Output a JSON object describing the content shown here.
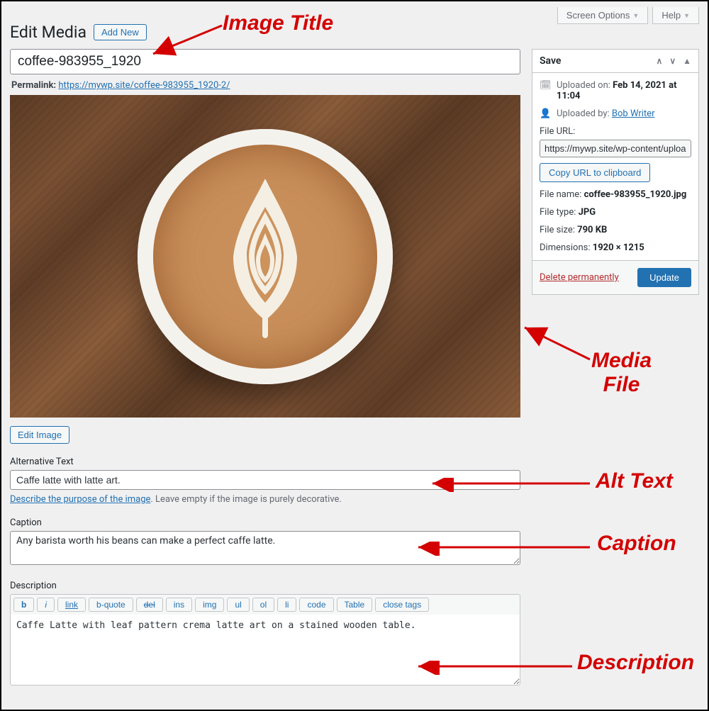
{
  "topBar": {
    "screenOptions": "Screen Options",
    "help": "Help"
  },
  "page": {
    "title": "Edit Media",
    "addNewLabel": "Add New"
  },
  "media": {
    "titleValue": "coffee-983955_1920",
    "permalinkLabel": "Permalink:",
    "permalinkUrl": "https://mywp.site/coffee-983955_1920-2/",
    "editImageLabel": "Edit Image",
    "altLabel": "Alternative Text",
    "altValue": "Caffe latte with latte art.",
    "altHelpLink": "Describe the purpose of the image",
    "altHelpRest": ". Leave empty if the image is purely decorative.",
    "captionLabel": "Caption",
    "captionValue": "Any barista worth his beans can make a perfect caffe latte.",
    "descLabel": "Description",
    "descValue": "Caffe Latte with leaf pattern crema latte art on a stained wooden table."
  },
  "quicktags": [
    "b",
    "i",
    "link",
    "b-quote",
    "del",
    "ins",
    "img",
    "ul",
    "ol",
    "li",
    "code",
    "Table",
    "close tags"
  ],
  "save": {
    "title": "Save",
    "uploadedOnLabel": "Uploaded on:",
    "uploadedOnValue": "Feb 14, 2021 at 11:04",
    "uploadedByLabel": "Uploaded by:",
    "uploadedByValue": "Bob Writer",
    "fileUrlLabel": "File URL:",
    "fileUrlValue": "https://mywp.site/wp-content/uploads/",
    "copyLabel": "Copy URL to clipboard",
    "fileNameLabel": "File name:",
    "fileNameValue": "coffee-983955_1920.jpg",
    "fileTypeLabel": "File type:",
    "fileTypeValue": "JPG",
    "fileSizeLabel": "File size:",
    "fileSizeValue": "790 KB",
    "dimLabel": "Dimensions:",
    "dimValue": "1920 × 1215",
    "deleteLabel": "Delete permanently",
    "updateLabel": "Update"
  },
  "annotations": {
    "imageTitle": "Image Title",
    "mediaFile": "Media\nFile",
    "altText": "Alt Text",
    "caption": "Caption",
    "description": "Description"
  }
}
